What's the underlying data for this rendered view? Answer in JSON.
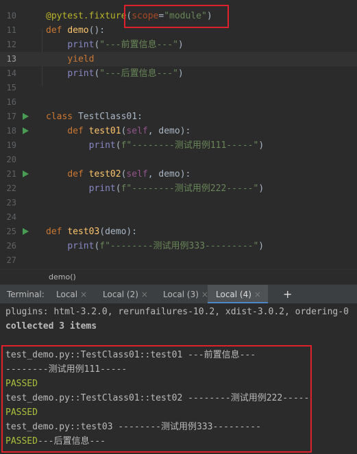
{
  "editor": {
    "current_line": "13",
    "lines": [
      {
        "num": "10",
        "parts": [
          {
            "t": "@pytest.fixture",
            "c": "deco"
          },
          {
            "t": "(",
            "c": ""
          },
          {
            "t": "scope",
            "c": "param"
          },
          {
            "t": "=",
            "c": ""
          },
          {
            "t": "\"module\"",
            "c": "str"
          },
          {
            "t": ")",
            "c": ""
          }
        ]
      },
      {
        "num": "11",
        "parts": [
          {
            "t": "def ",
            "c": "kw"
          },
          {
            "t": "demo",
            "c": "fn"
          },
          {
            "t": "():",
            "c": ""
          }
        ]
      },
      {
        "num": "12",
        "parts": [
          {
            "t": "    ",
            "c": ""
          },
          {
            "t": "print",
            "c": "bi"
          },
          {
            "t": "(",
            "c": ""
          },
          {
            "t": "\"---前置信息---\"",
            "c": "str"
          },
          {
            "t": ")",
            "c": ""
          }
        ]
      },
      {
        "num": "13",
        "parts": [
          {
            "t": "    ",
            "c": ""
          },
          {
            "t": "yield",
            "c": "kw"
          }
        ]
      },
      {
        "num": "14",
        "parts": [
          {
            "t": "    ",
            "c": ""
          },
          {
            "t": "print",
            "c": "bi"
          },
          {
            "t": "(",
            "c": ""
          },
          {
            "t": "\"---后置信息---\"",
            "c": "str"
          },
          {
            "t": ")",
            "c": ""
          }
        ]
      },
      {
        "num": "15",
        "parts": []
      },
      {
        "num": "16",
        "parts": []
      },
      {
        "num": "17",
        "run": true,
        "parts": [
          {
            "t": "class ",
            "c": "kw"
          },
          {
            "t": "TestClass01",
            "c": ""
          },
          {
            "t": ":",
            "c": ""
          }
        ]
      },
      {
        "num": "18",
        "run": true,
        "parts": [
          {
            "t": "    ",
            "c": ""
          },
          {
            "t": "def ",
            "c": "kw"
          },
          {
            "t": "test01",
            "c": "fn"
          },
          {
            "t": "(",
            "c": ""
          },
          {
            "t": "self",
            "c": "self"
          },
          {
            "t": ", demo):",
            "c": ""
          }
        ]
      },
      {
        "num": "19",
        "parts": [
          {
            "t": "        ",
            "c": ""
          },
          {
            "t": "print",
            "c": "bi"
          },
          {
            "t": "(",
            "c": ""
          },
          {
            "t": "f\"--------测试用例111-----\"",
            "c": "str"
          },
          {
            "t": ")",
            "c": ""
          }
        ]
      },
      {
        "num": "20",
        "parts": []
      },
      {
        "num": "21",
        "run": true,
        "parts": [
          {
            "t": "    ",
            "c": ""
          },
          {
            "t": "def ",
            "c": "kw"
          },
          {
            "t": "test02",
            "c": "fn"
          },
          {
            "t": "(",
            "c": ""
          },
          {
            "t": "self",
            "c": "self"
          },
          {
            "t": ", demo):",
            "c": ""
          }
        ]
      },
      {
        "num": "22",
        "parts": [
          {
            "t": "        ",
            "c": ""
          },
          {
            "t": "print",
            "c": "bi"
          },
          {
            "t": "(",
            "c": ""
          },
          {
            "t": "f\"--------测试用例222-----\"",
            "c": "str"
          },
          {
            "t": ")",
            "c": ""
          }
        ]
      },
      {
        "num": "23",
        "parts": []
      },
      {
        "num": "24",
        "parts": []
      },
      {
        "num": "25",
        "run": true,
        "parts": [
          {
            "t": "def ",
            "c": "kw"
          },
          {
            "t": "test03",
            "c": "fn"
          },
          {
            "t": "(demo):",
            "c": ""
          }
        ]
      },
      {
        "num": "26",
        "parts": [
          {
            "t": "    ",
            "c": ""
          },
          {
            "t": "print",
            "c": "bi"
          },
          {
            "t": "(",
            "c": ""
          },
          {
            "t": "f\"--------测试用例333---------\"",
            "c": "str"
          },
          {
            "t": ")",
            "c": ""
          }
        ]
      },
      {
        "num": "27",
        "parts": []
      }
    ]
  },
  "breadcrumb": "demo()",
  "terminal": {
    "label": "Terminal:",
    "tabs": [
      {
        "label": "Local",
        "active": false
      },
      {
        "label": "Local (2)",
        "active": false
      },
      {
        "label": "Local (3)",
        "active": false
      },
      {
        "label": "Local (4)",
        "active": true
      }
    ],
    "close_glyph": "×",
    "add_glyph": "+",
    "output": [
      {
        "t": "plugins: html-3.2.0, rerunfailures-10.2, xdist-3.0.2, ordering-0",
        "s": ""
      },
      {
        "t": "collected 3 items",
        "s": "bold"
      },
      {
        "t": "",
        "s": ""
      },
      {
        "t": "test_demo.py::TestClass01::test01 ---前置信息---",
        "s": ""
      },
      {
        "t": "--------测试用例111-----",
        "s": ""
      },
      {
        "t": "PASSED",
        "s": "pass"
      },
      {
        "t": "test_demo.py::TestClass01::test02 --------测试用例222-----",
        "s": ""
      },
      {
        "t": "PASSED",
        "s": "pass"
      },
      {
        "t": "test_demo.py::test03 --------测试用例333---------",
        "s": ""
      },
      {
        "t": "PASSED",
        "s": "pass",
        "suffix": "---后置信息---"
      }
    ]
  },
  "colors": {
    "highlight_box": "#e0202a",
    "passed": "#a9c13b",
    "run_icon": "#499c54"
  }
}
